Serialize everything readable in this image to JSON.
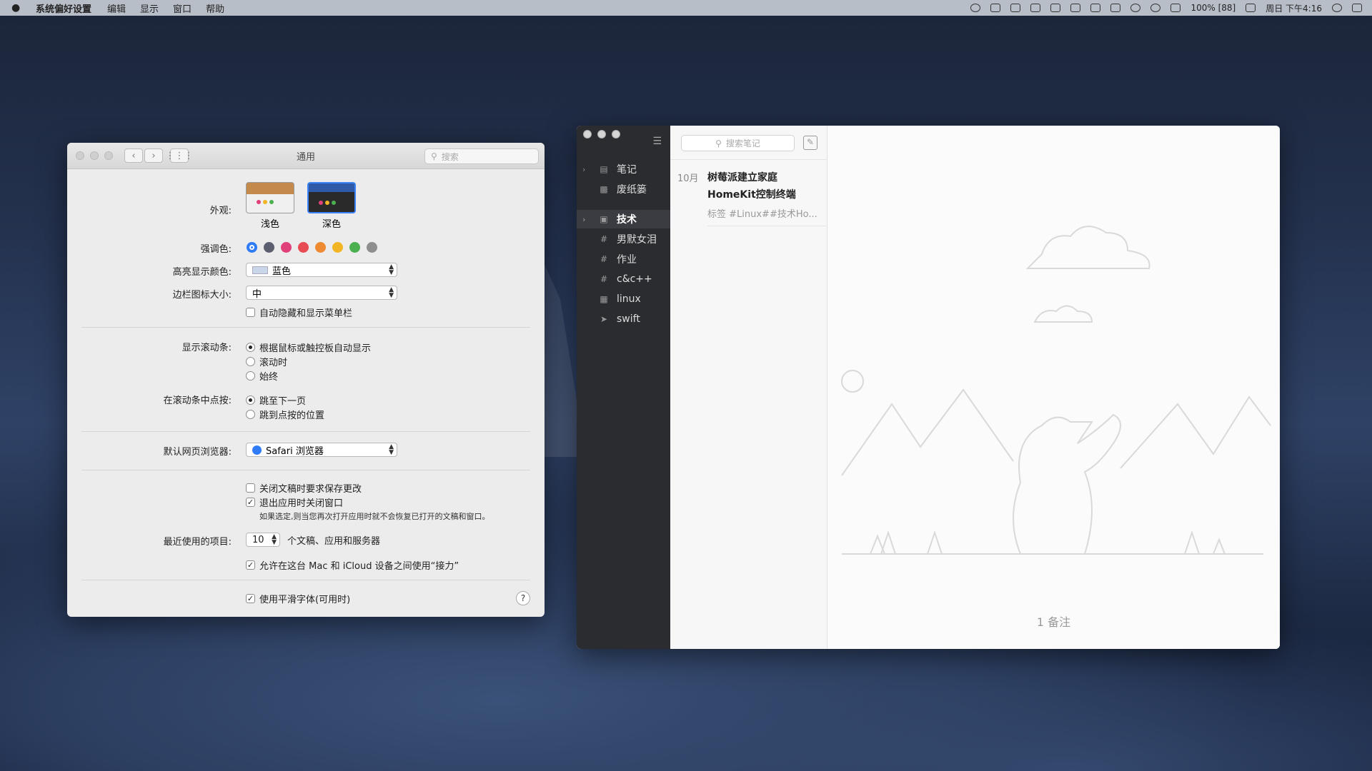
{
  "menubar": {
    "apple": "",
    "app_name": "系统偏好设置",
    "items": [
      "编辑",
      "显示",
      "窗口",
      "帮助"
    ],
    "right": [
      "100% [88]",
      "周日 下午4:16"
    ]
  },
  "prefs": {
    "title": "通用",
    "search_placeholder": "搜索",
    "appearance_label": "外观:",
    "appearance_light": "浅色",
    "appearance_dark": "深色",
    "accent_label": "强调色:",
    "accent_colors": [
      "#2f7cf6",
      "#5b5f70",
      "#e0417a",
      "#e74c52",
      "#ee8a32",
      "#f2b526",
      "#4caf50",
      "#8e8e8e"
    ],
    "highlight_label": "高亮显示颜色:",
    "highlight_value": "蓝色",
    "sidebar_icon_label": "边栏图标大小:",
    "sidebar_icon_value": "中",
    "autohide_menubar": "自动隐藏和显示菜单栏",
    "scrollbar_label": "显示滚动条:",
    "scrollbar_options": [
      "根据鼠标或触控板自动显示",
      "滚动时",
      "始终"
    ],
    "click_label": "在滚动条中点按:",
    "click_options": [
      "跳至下一页",
      "跳到点按的位置"
    ],
    "browser_label": "默认网页浏览器:",
    "browser_value": "Safari 浏览器",
    "ask_save": "关闭文稿时要求保存更改",
    "close_windows": "退出应用时关闭窗口",
    "close_windows_note": "如果选定,则当您再次打开应用时就不会恢复已打开的文稿和窗口。",
    "recent_label": "最近使用的项目:",
    "recent_value": "10",
    "recent_suffix": "个文稿、应用和服务器",
    "handoff": "允许在这台 Mac 和 iCloud 设备之间使用“接力”",
    "smooth_fonts": "使用平滑字体(可用时)",
    "help": "?"
  },
  "notes": {
    "sidebar": [
      {
        "label": "笔记",
        "icon": "note-icon"
      },
      {
        "label": "废纸篓",
        "icon": "trash-icon"
      },
      {
        "label": "技术",
        "icon": "tag-icon"
      },
      {
        "label": "男默女泪",
        "icon": "hash-icon"
      },
      {
        "label": "作业",
        "icon": "hash-icon"
      },
      {
        "label": "c&c++",
        "icon": "hash-icon"
      },
      {
        "label": "linux",
        "icon": "linux-icon"
      },
      {
        "label": "swift",
        "icon": "swift-icon"
      }
    ],
    "search_placeholder": "搜索笔记",
    "note": {
      "date": "10月",
      "title_line1": "树莓派建立家庭",
      "title_line2": "HomeKit控制终端",
      "tags": "标签 #Linux##技术Ho..."
    },
    "count": "1 备注"
  }
}
